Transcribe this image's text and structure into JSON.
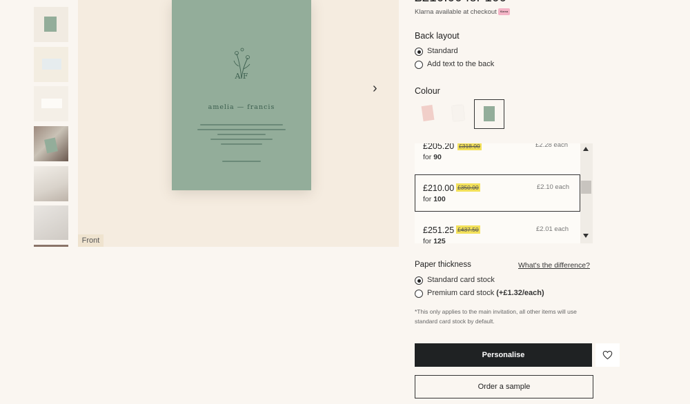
{
  "price_header": {
    "partial_text": "£210.00 for 100"
  },
  "klarna": {
    "text": "Klarna available at checkout",
    "badge": "Klarna"
  },
  "back_layout": {
    "heading": "Back layout",
    "options": [
      {
        "label": "Standard",
        "selected": true
      },
      {
        "label": "Add text to the back",
        "selected": false
      }
    ]
  },
  "colour": {
    "heading": "Colour",
    "swatches": [
      {
        "name": "blush-speckle",
        "color": "#f1cfc9"
      },
      {
        "name": "white-floral",
        "color": "#f5f1ec"
      },
      {
        "name": "sage-green",
        "color": "#93ad9a",
        "selected": true
      }
    ]
  },
  "quantities": [
    {
      "price": "£205.20",
      "was": "£318.00",
      "each": "£2.28 each",
      "for_label": "for",
      "qty": "90",
      "selected": false
    },
    {
      "price": "£210.00",
      "was": "£350.00",
      "each": "£2.10 each",
      "for_label": "for",
      "qty": "100",
      "selected": true
    },
    {
      "price": "£251.25",
      "was": "£437.50",
      "each": "£2.01 each",
      "for_label": "for",
      "qty": "125",
      "selected": false
    }
  ],
  "paper": {
    "heading": "Paper thickness",
    "difference_link": "What's the difference?",
    "options": [
      {
        "label": "Standard card stock",
        "extra": "",
        "selected": true
      },
      {
        "label": "Premium card stock",
        "extra": "(+£1.32/each)",
        "selected": false
      }
    ],
    "note": "*This only applies to the main invitation, all other items will use standard card stock by default."
  },
  "preview": {
    "label": "Front",
    "card_monogram": "A  F",
    "card_names": "amelia  —  francis",
    "card_body_lines": [
      "invite you to celebrate their wedding",
      "at the hour of sixteen on the date of",
      "the venue name and address",
      "reception to follow",
      "rsvp to the couple"
    ]
  },
  "actions": {
    "personalise": "Personalise",
    "order_sample": "Order a sample"
  },
  "accent": {
    "dark_button": "#1f2223",
    "highlight": "#f3e15a",
    "card_green": "#93ad9a"
  }
}
